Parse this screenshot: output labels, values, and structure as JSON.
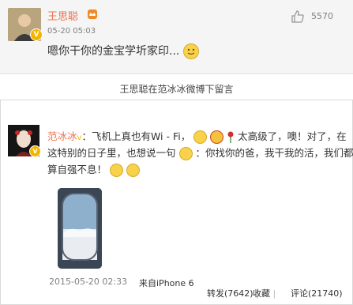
{
  "comment": {
    "user_name": "王思聪",
    "timestamp": "05-20 05:03",
    "text": "嗯你干你的金宝学圻家印...",
    "like_count": "5570",
    "icons": [
      "avatar",
      "verified-badge",
      "crown-icon",
      "smile-emoji",
      "thumbs-up-icon"
    ]
  },
  "caption": "王思聪在范冰冰微博下留言",
  "post": {
    "user_name": "范冰冰",
    "separator": "：",
    "line1_a": "飞机上真也有Wi - Fi，",
    "line1_b": "太高级了，噢！对了，在",
    "line2_a": "这特别的日子里，也想说一句",
    "line2_b": "：你找你的爸，我干我的活，我们都",
    "line3": "算自强不息！",
    "timestamp": "2015-05-20 02:33",
    "source": "来自iPhone 6",
    "forward_label": "转发(7642)",
    "collect_label": "收藏",
    "comment_label": "评论(21740)"
  },
  "colors": {
    "accent": "#eb7350",
    "badge": "#f5b400"
  }
}
